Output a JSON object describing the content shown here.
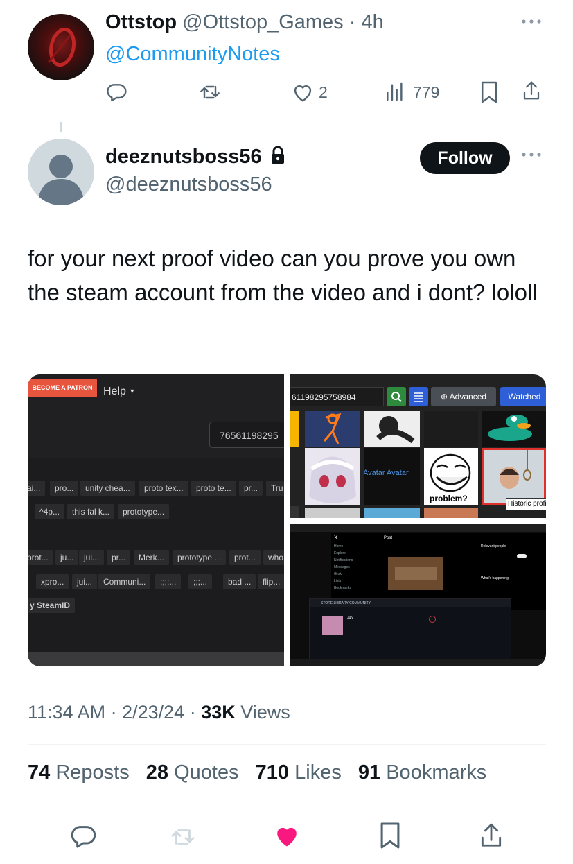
{
  "reply": {
    "name": "Ottstop",
    "handle": "@Ottstop_Games",
    "time": "4h",
    "mention": "@CommunityNotes",
    "likes": "2",
    "views": "779"
  },
  "tweet": {
    "name": "deeznutsboss56",
    "handle": "@deeznutsboss56",
    "follow_label": "Follow",
    "text": "for your next proof video can you prove you own the steam account from the video and i dont? lololl",
    "time": "11:34 AM",
    "date": "2/23/24",
    "views_count": "33K",
    "views_label": "Views",
    "reposts_count": "74",
    "reposts_label": "Reposts",
    "quotes_count": "28",
    "quotes_label": "Quotes",
    "likes_count": "710",
    "likes_label": "Likes",
    "bookmarks_count": "91",
    "bookmarks_label": "Bookmarks"
  },
  "media1": {
    "patron": "BECOME A PATRON",
    "help": "Help",
    "input_value": "76561198295",
    "row1": [
      "ai...",
      "pro...",
      "unity chea...",
      "proto tex...",
      "proto te...",
      "pr...",
      "Tru"
    ],
    "row2": [
      "^4p...",
      "this fal k...",
      "prototype..."
    ],
    "row3": [
      "prot...",
      "ju...",
      "jui...",
      "pr...",
      "Merk...",
      "prototype ...",
      "prot...",
      "who"
    ],
    "row4": [
      "xpro...",
      "jui...",
      "Communi...",
      ";;;;...",
      ";;;...",
      "bad ...",
      "flip..."
    ],
    "steamid": "y SteamID"
  },
  "media2": {
    "input_value": "61198295758984",
    "advanced": "Advanced",
    "watched": "Watched",
    "avatar_link": "Avatar  Avatar",
    "problem": "problem?",
    "historic": "Historic profi"
  },
  "media3": {
    "post_label": "Post",
    "relevant": "Relevant people",
    "happening": "What's happening",
    "steam_nav": "STORE   LIBRARY   COMMUNITY",
    "user": "July"
  },
  "colors": {
    "accent": "#1d9bf0",
    "like_pink": "#f91880",
    "text": "#0f1419",
    "secondary": "#536471"
  }
}
